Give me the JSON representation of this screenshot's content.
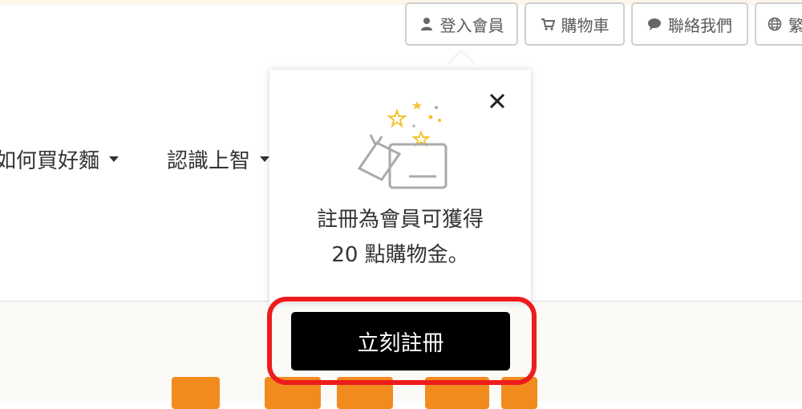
{
  "header": {
    "utility_buttons": {
      "login": {
        "label": "登入會員",
        "icon": "user-icon"
      },
      "cart": {
        "label": "購物車",
        "icon": "cart-icon"
      },
      "contact": {
        "label": "聯絡我們",
        "icon": "chat-bubble-icon"
      },
      "language": {
        "label": "繁",
        "icon": "globe-icon"
      }
    }
  },
  "nav": {
    "items": [
      {
        "label": "如何買好麵"
      },
      {
        "label": "認識上智"
      }
    ]
  },
  "popover": {
    "icon": "gift-box-icon",
    "message": "註冊為會員可獲得 20 點購物金。",
    "register_button": "立刻註冊",
    "close_icon": "close-icon"
  },
  "colors": {
    "register_bg": "#000000",
    "highlight": "#ee1c1c",
    "banner_accent": "#f28b1e"
  }
}
